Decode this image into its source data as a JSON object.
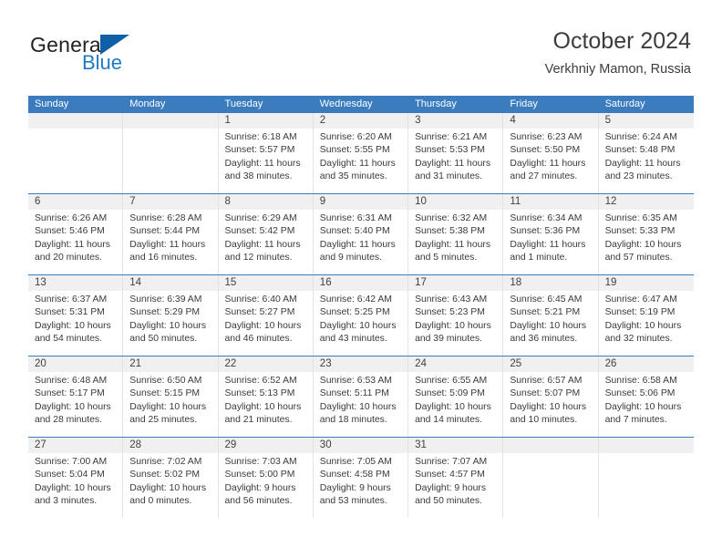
{
  "brand": {
    "name_part1": "General",
    "name_part2": "Blue",
    "flag_icon": "blue-triangle-flag-icon"
  },
  "header": {
    "title": "October 2024",
    "subtitle": "Verkhniy Mamon, Russia"
  },
  "colors": {
    "header_blue": "#3a7cbe",
    "brand_blue": "#1f7ac4",
    "day_band_grey": "#f0f0f0",
    "cell_border": "#e3e3e3"
  },
  "labels": {
    "sunrise_prefix": "Sunrise:",
    "sunset_prefix": "Sunset:",
    "daylight_prefix": "Daylight:"
  },
  "weekdays": [
    "Sunday",
    "Monday",
    "Tuesday",
    "Wednesday",
    "Thursday",
    "Friday",
    "Saturday"
  ],
  "weeks": [
    [
      {
        "day": "",
        "sunrise": "",
        "sunset": "",
        "daylight": "",
        "empty": true
      },
      {
        "day": "",
        "sunrise": "",
        "sunset": "",
        "daylight": "",
        "empty": true
      },
      {
        "day": "1",
        "sunrise": "Sunrise: 6:18 AM",
        "sunset": "Sunset: 5:57 PM",
        "daylight": "Daylight: 11 hours and 38 minutes."
      },
      {
        "day": "2",
        "sunrise": "Sunrise: 6:20 AM",
        "sunset": "Sunset: 5:55 PM",
        "daylight": "Daylight: 11 hours and 35 minutes."
      },
      {
        "day": "3",
        "sunrise": "Sunrise: 6:21 AM",
        "sunset": "Sunset: 5:53 PM",
        "daylight": "Daylight: 11 hours and 31 minutes."
      },
      {
        "day": "4",
        "sunrise": "Sunrise: 6:23 AM",
        "sunset": "Sunset: 5:50 PM",
        "daylight": "Daylight: 11 hours and 27 minutes."
      },
      {
        "day": "5",
        "sunrise": "Sunrise: 6:24 AM",
        "sunset": "Sunset: 5:48 PM",
        "daylight": "Daylight: 11 hours and 23 minutes."
      }
    ],
    [
      {
        "day": "6",
        "sunrise": "Sunrise: 6:26 AM",
        "sunset": "Sunset: 5:46 PM",
        "daylight": "Daylight: 11 hours and 20 minutes."
      },
      {
        "day": "7",
        "sunrise": "Sunrise: 6:28 AM",
        "sunset": "Sunset: 5:44 PM",
        "daylight": "Daylight: 11 hours and 16 minutes."
      },
      {
        "day": "8",
        "sunrise": "Sunrise: 6:29 AM",
        "sunset": "Sunset: 5:42 PM",
        "daylight": "Daylight: 11 hours and 12 minutes."
      },
      {
        "day": "9",
        "sunrise": "Sunrise: 6:31 AM",
        "sunset": "Sunset: 5:40 PM",
        "daylight": "Daylight: 11 hours and 9 minutes."
      },
      {
        "day": "10",
        "sunrise": "Sunrise: 6:32 AM",
        "sunset": "Sunset: 5:38 PM",
        "daylight": "Daylight: 11 hours and 5 minutes."
      },
      {
        "day": "11",
        "sunrise": "Sunrise: 6:34 AM",
        "sunset": "Sunset: 5:36 PM",
        "daylight": "Daylight: 11 hours and 1 minute."
      },
      {
        "day": "12",
        "sunrise": "Sunrise: 6:35 AM",
        "sunset": "Sunset: 5:33 PM",
        "daylight": "Daylight: 10 hours and 57 minutes."
      }
    ],
    [
      {
        "day": "13",
        "sunrise": "Sunrise: 6:37 AM",
        "sunset": "Sunset: 5:31 PM",
        "daylight": "Daylight: 10 hours and 54 minutes."
      },
      {
        "day": "14",
        "sunrise": "Sunrise: 6:39 AM",
        "sunset": "Sunset: 5:29 PM",
        "daylight": "Daylight: 10 hours and 50 minutes."
      },
      {
        "day": "15",
        "sunrise": "Sunrise: 6:40 AM",
        "sunset": "Sunset: 5:27 PM",
        "daylight": "Daylight: 10 hours and 46 minutes."
      },
      {
        "day": "16",
        "sunrise": "Sunrise: 6:42 AM",
        "sunset": "Sunset: 5:25 PM",
        "daylight": "Daylight: 10 hours and 43 minutes."
      },
      {
        "day": "17",
        "sunrise": "Sunrise: 6:43 AM",
        "sunset": "Sunset: 5:23 PM",
        "daylight": "Daylight: 10 hours and 39 minutes."
      },
      {
        "day": "18",
        "sunrise": "Sunrise: 6:45 AM",
        "sunset": "Sunset: 5:21 PM",
        "daylight": "Daylight: 10 hours and 36 minutes."
      },
      {
        "day": "19",
        "sunrise": "Sunrise: 6:47 AM",
        "sunset": "Sunset: 5:19 PM",
        "daylight": "Daylight: 10 hours and 32 minutes."
      }
    ],
    [
      {
        "day": "20",
        "sunrise": "Sunrise: 6:48 AM",
        "sunset": "Sunset: 5:17 PM",
        "daylight": "Daylight: 10 hours and 28 minutes."
      },
      {
        "day": "21",
        "sunrise": "Sunrise: 6:50 AM",
        "sunset": "Sunset: 5:15 PM",
        "daylight": "Daylight: 10 hours and 25 minutes."
      },
      {
        "day": "22",
        "sunrise": "Sunrise: 6:52 AM",
        "sunset": "Sunset: 5:13 PM",
        "daylight": "Daylight: 10 hours and 21 minutes."
      },
      {
        "day": "23",
        "sunrise": "Sunrise: 6:53 AM",
        "sunset": "Sunset: 5:11 PM",
        "daylight": "Daylight: 10 hours and 18 minutes."
      },
      {
        "day": "24",
        "sunrise": "Sunrise: 6:55 AM",
        "sunset": "Sunset: 5:09 PM",
        "daylight": "Daylight: 10 hours and 14 minutes."
      },
      {
        "day": "25",
        "sunrise": "Sunrise: 6:57 AM",
        "sunset": "Sunset: 5:07 PM",
        "daylight": "Daylight: 10 hours and 10 minutes."
      },
      {
        "day": "26",
        "sunrise": "Sunrise: 6:58 AM",
        "sunset": "Sunset: 5:06 PM",
        "daylight": "Daylight: 10 hours and 7 minutes."
      }
    ],
    [
      {
        "day": "27",
        "sunrise": "Sunrise: 7:00 AM",
        "sunset": "Sunset: 5:04 PM",
        "daylight": "Daylight: 10 hours and 3 minutes."
      },
      {
        "day": "28",
        "sunrise": "Sunrise: 7:02 AM",
        "sunset": "Sunset: 5:02 PM",
        "daylight": "Daylight: 10 hours and 0 minutes."
      },
      {
        "day": "29",
        "sunrise": "Sunrise: 7:03 AM",
        "sunset": "Sunset: 5:00 PM",
        "daylight": "Daylight: 9 hours and 56 minutes."
      },
      {
        "day": "30",
        "sunrise": "Sunrise: 7:05 AM",
        "sunset": "Sunset: 4:58 PM",
        "daylight": "Daylight: 9 hours and 53 minutes."
      },
      {
        "day": "31",
        "sunrise": "Sunrise: 7:07 AM",
        "sunset": "Sunset: 4:57 PM",
        "daylight": "Daylight: 9 hours and 50 minutes."
      },
      {
        "day": "",
        "sunrise": "",
        "sunset": "",
        "daylight": "",
        "empty": true
      },
      {
        "day": "",
        "sunrise": "",
        "sunset": "",
        "daylight": "",
        "empty": true
      }
    ]
  ]
}
